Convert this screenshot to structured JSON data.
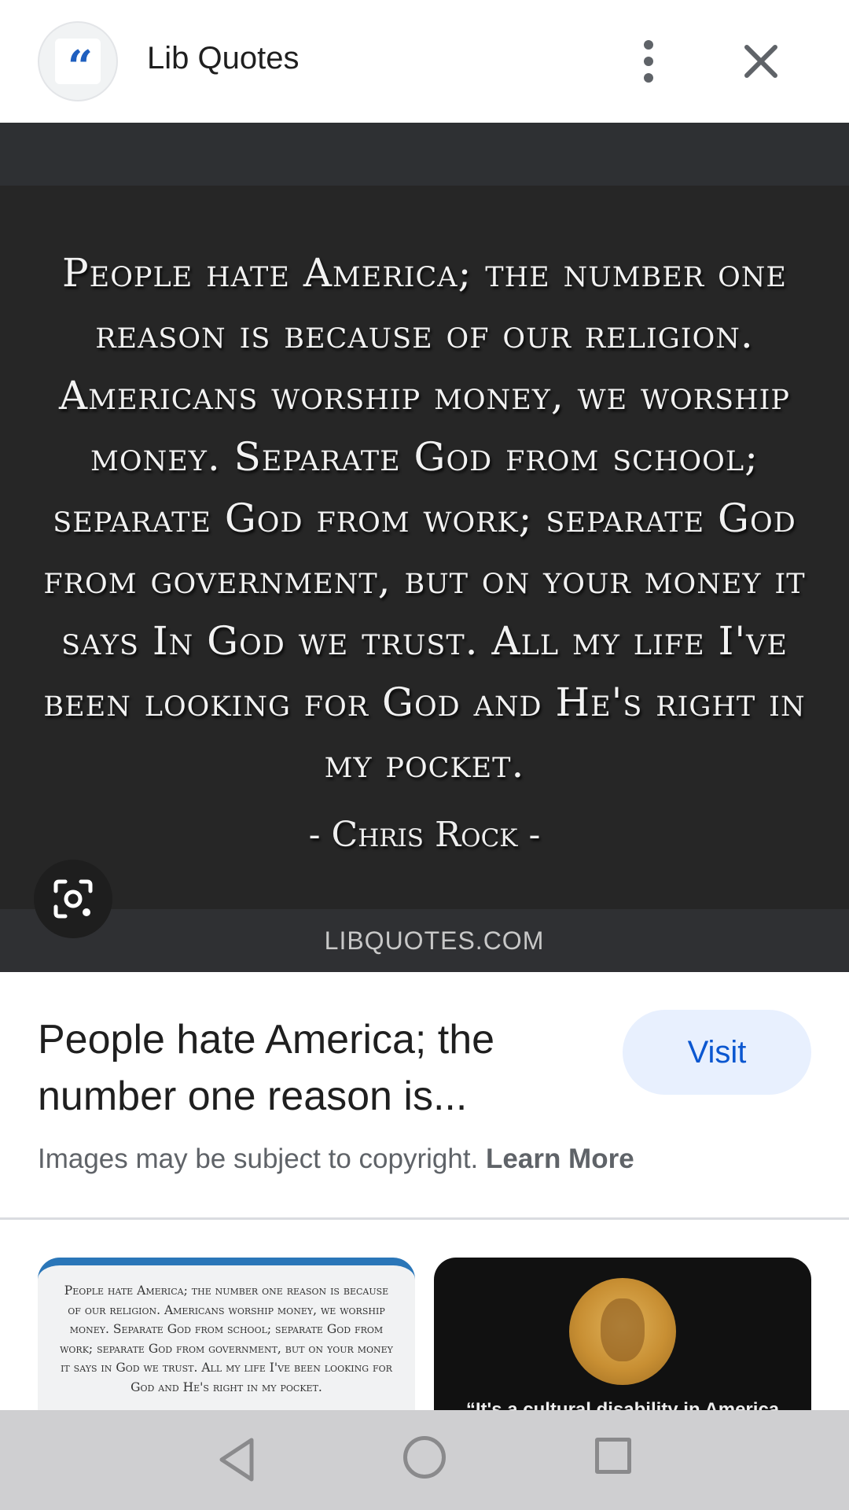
{
  "header": {
    "site_logo_glyph": "“",
    "site_name": "Lib Quotes",
    "more_icon": "more-vert-icon",
    "close_icon": "close-icon"
  },
  "image": {
    "quote": "People hate America; the number one reason is because of our religion. Americans worship money, we worship money. Separate God from school; separate God from work; separate God from government, but on your money it says In God we trust. All my life I've been looking for God and He's right in my pocket.",
    "author": "- Chris Rock -",
    "source": "LIBQUOTES.COM",
    "lens_icon": "google-lens-icon"
  },
  "result": {
    "title": "People hate America; the number one reason is...",
    "visit_label": "Visit",
    "copyright_text": "Images may be subject to copyright.",
    "learn_more_label": "Learn More"
  },
  "related": [
    {
      "text": "People hate America; the number one reason is because of our religion. Americans worship money, we worship money. Separate God from school; separate God from work; separate God from government, but on your money it says in God we trust. All my life I've been looking for God and He's right in my pocket."
    },
    {
      "text": "“It's a cultural disability in America"
    }
  ],
  "navbar": {
    "back_icon": "back-triangle-icon",
    "home_icon": "home-circle-icon",
    "recents_icon": "recents-square-icon"
  },
  "colors": {
    "accent": "#0b57d0",
    "visit_bg": "#e8f0fe",
    "viewer_bg": "#262626"
  }
}
